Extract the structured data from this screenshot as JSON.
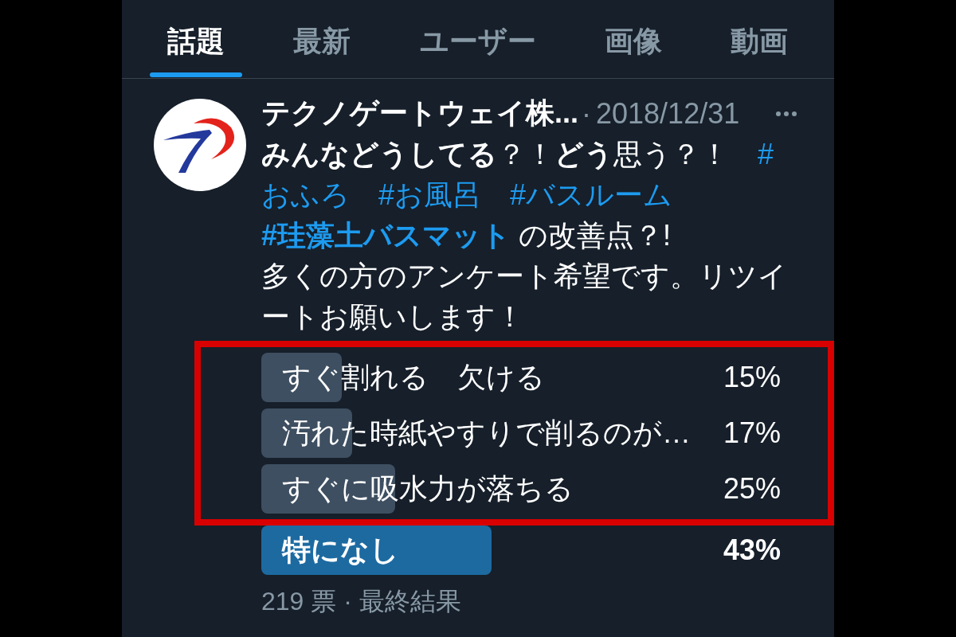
{
  "tabs": [
    {
      "label": "話題",
      "selected": true
    },
    {
      "label": "最新",
      "selected": false
    },
    {
      "label": "ユーザー",
      "selected": false
    },
    {
      "label": "画像",
      "selected": false
    },
    {
      "label": "動画",
      "selected": false
    }
  ],
  "tweet": {
    "author": "テクノゲートウェイ株...",
    "separator": "·",
    "date": "2018/12/31",
    "text_lines": [
      [
        {
          "kind": "text",
          "text": "**みんなどうしてる**？！**どう**思う？！　"
        },
        {
          "kind": "hashtag",
          "text": "#",
          "bold": false
        }
      ],
      [
        {
          "kind": "hashtag",
          "text": "おふろ",
          "bold": false
        },
        {
          "kind": "hashtag",
          "text": "#お風呂",
          "bold": false
        },
        {
          "kind": "hashtag",
          "text": "#バスルーム",
          "bold": false
        }
      ],
      [
        {
          "kind": "hashtag",
          "text": "#珪藻土バスマット",
          "bold": true
        },
        {
          "kind": "text",
          "text": " の改善点？!"
        }
      ],
      [
        {
          "kind": "text",
          "text": "多くの方のアンケート希望です。リツイ"
        }
      ],
      [
        {
          "kind": "text",
          "text": "ートお願いします！"
        }
      ]
    ],
    "poll": {
      "options": [
        {
          "label": "すぐ割れる　欠ける",
          "percent": "15%",
          "level": 0.15,
          "winner": false,
          "highlighted": true
        },
        {
          "label": "汚れた時紙やすりで削るのが…",
          "percent": "17%",
          "level": 0.17,
          "winner": false,
          "highlighted": true
        },
        {
          "label": "すぐに吸水力が落ちる",
          "percent": "25%",
          "level": 0.25,
          "winner": false,
          "highlighted": true
        },
        {
          "label": "特になし",
          "percent": "43%",
          "level": 0.43,
          "winner": true,
          "highlighted": false
        }
      ],
      "footer": "219 票 · 最終結果"
    }
  }
}
